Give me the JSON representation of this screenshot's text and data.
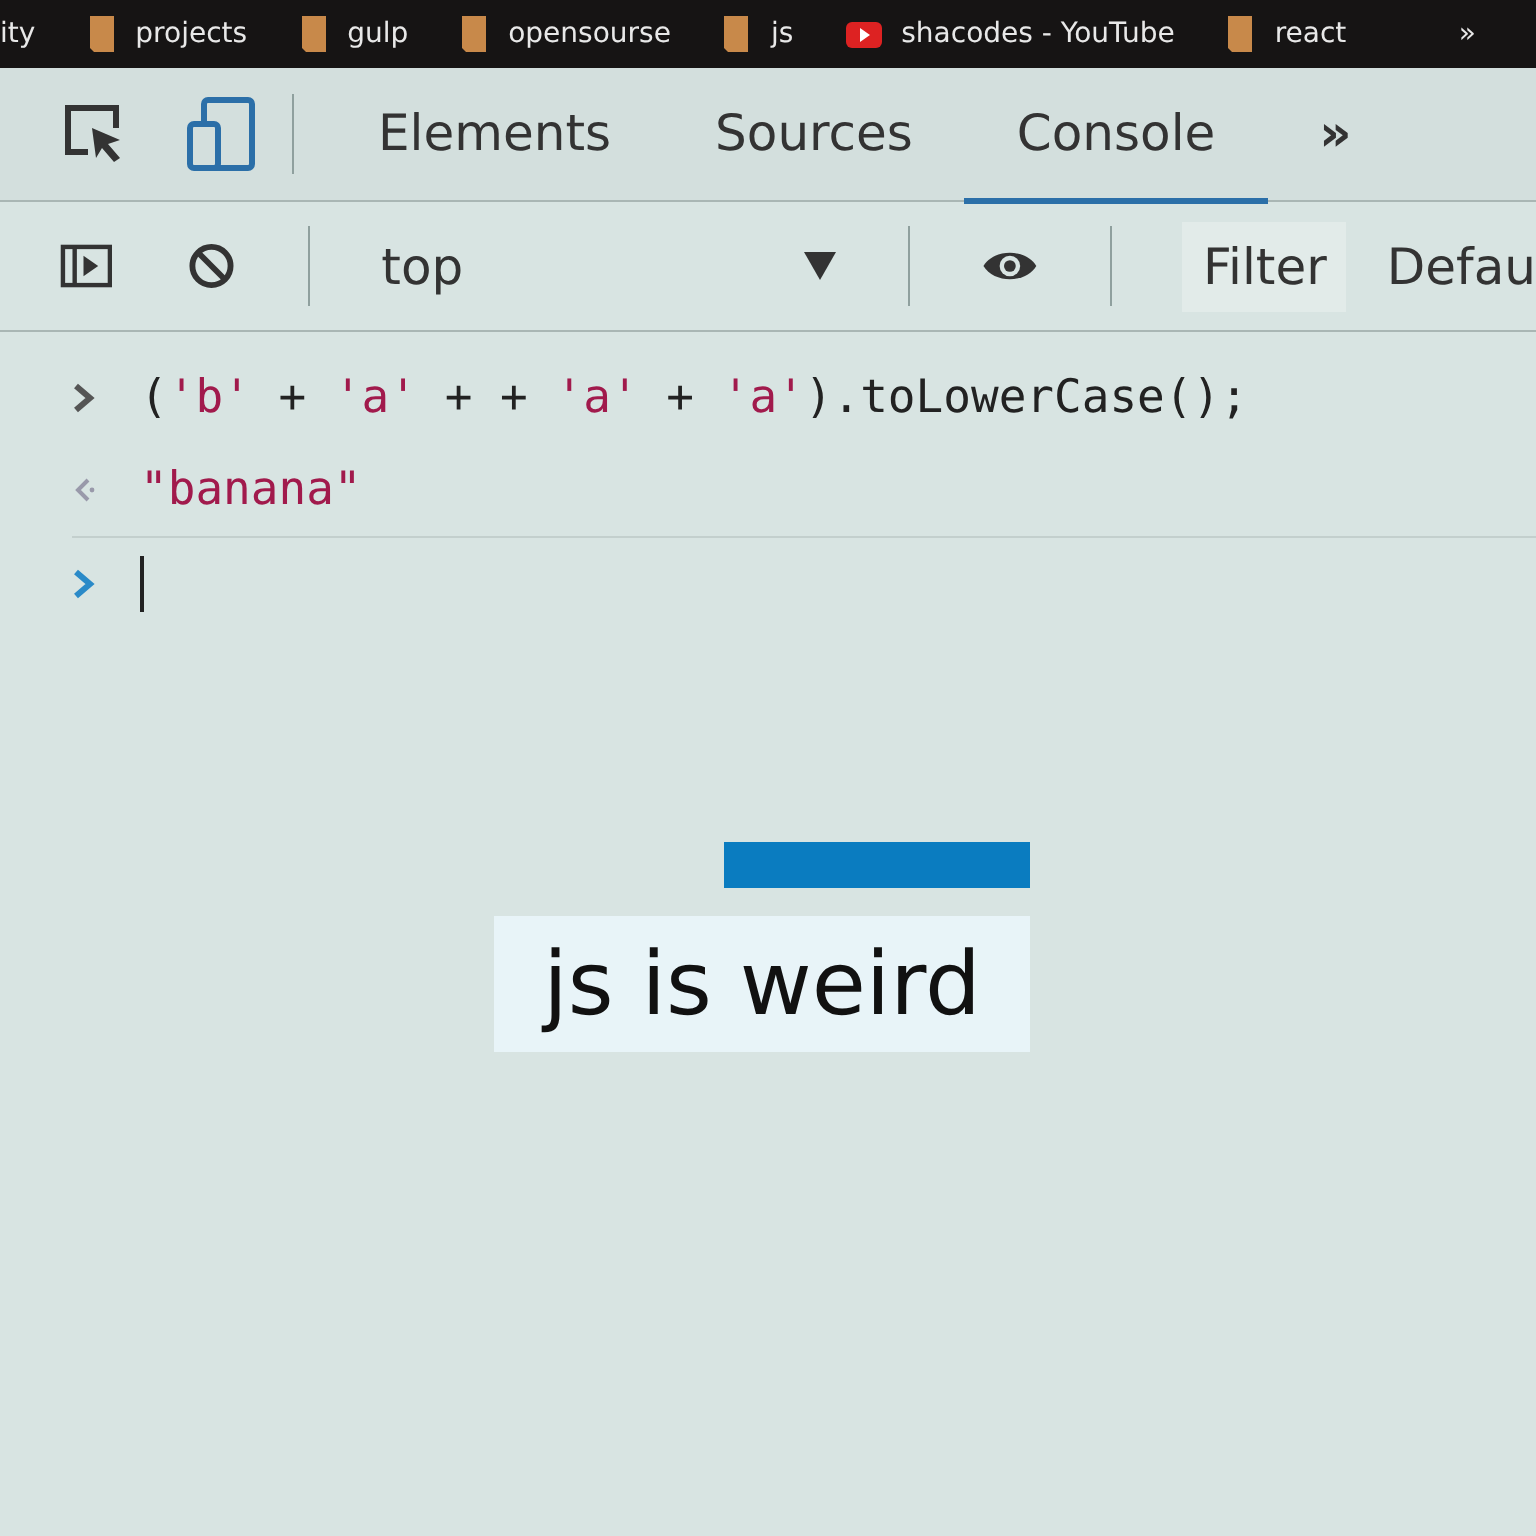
{
  "bookmarks_bar": {
    "items": [
      {
        "kind": "text",
        "label": "ity"
      },
      {
        "kind": "folder",
        "label": "projects"
      },
      {
        "kind": "folder",
        "label": "gulp"
      },
      {
        "kind": "folder",
        "label": "opensourse"
      },
      {
        "kind": "folder",
        "label": "js"
      },
      {
        "kind": "video",
        "label": "shacodes - YouTube"
      },
      {
        "kind": "folder",
        "label": "react"
      }
    ],
    "more": "»"
  },
  "devtools_tabs": [
    {
      "label": "Elements",
      "selected": false
    },
    {
      "label": "Sources",
      "selected": false
    },
    {
      "label": "Console",
      "selected": true
    }
  ],
  "more_tabs": "»",
  "console_toolbar": {
    "context": "top",
    "filter": "Filter",
    "levels": "Defau"
  },
  "console": {
    "lines": [
      {
        "kind": "input",
        "segments": [
          {
            "kind": "plain",
            "text": "("
          },
          {
            "kind": "string",
            "text": "'b'"
          },
          {
            "kind": "plain",
            "text": " + "
          },
          {
            "kind": "string",
            "text": "'a'"
          },
          {
            "kind": "plain",
            "text": " + + "
          },
          {
            "kind": "string",
            "text": "'a'"
          },
          {
            "kind": "plain",
            "text": " + "
          },
          {
            "kind": "string",
            "text": "'a'"
          },
          {
            "kind": "plain",
            "text": ").toLowerCase();"
          }
        ]
      },
      {
        "kind": "output",
        "segments": [
          {
            "kind": "string",
            "text": "\"banana\""
          }
        ]
      },
      {
        "kind": "prompt"
      }
    ]
  },
  "caption": "js is weird"
}
